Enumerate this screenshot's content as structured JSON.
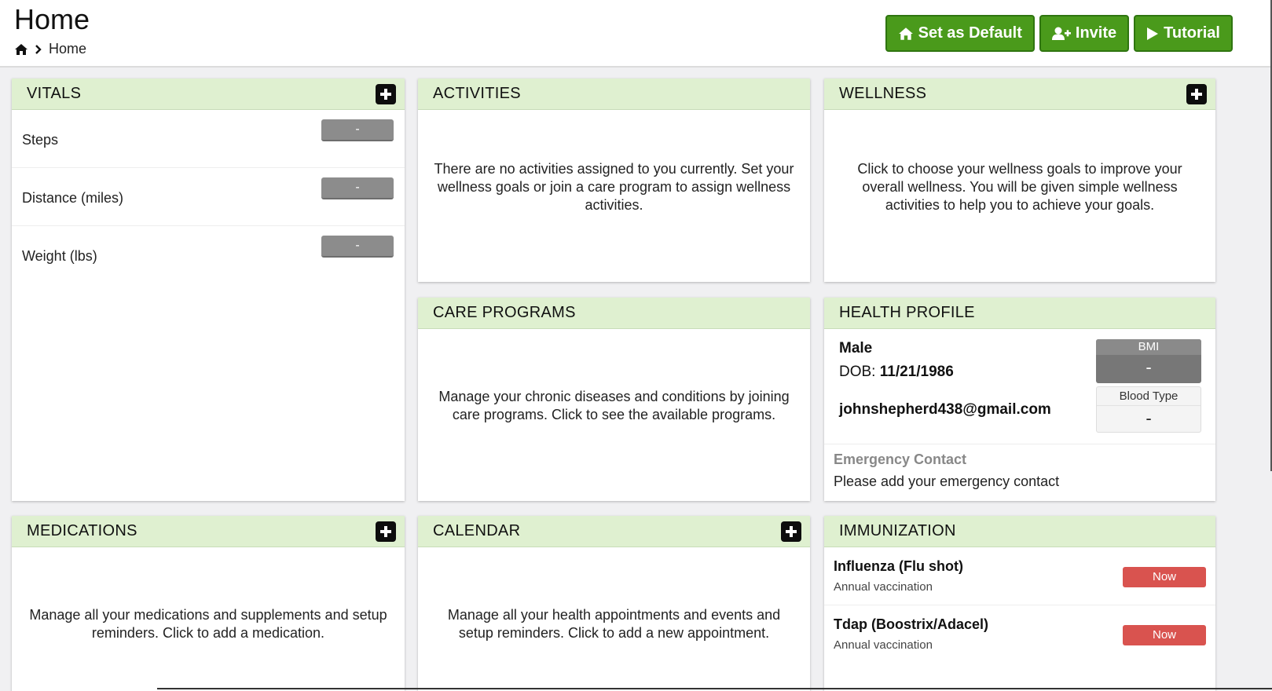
{
  "header": {
    "title": "Home",
    "breadcrumb": {
      "home_icon": "home-icon",
      "separator_icon": "chevron-right-icon",
      "current": "Home"
    },
    "buttons": {
      "set_default": {
        "label": "Set as Default",
        "icon": "home-icon"
      },
      "invite": {
        "label": "Invite",
        "icon": "user-plus-icon"
      },
      "tutorial": {
        "label": "Tutorial",
        "icon": "play-icon"
      }
    }
  },
  "colors": {
    "accent_green": "#4a9a1b",
    "panel_header": "#dff0d0",
    "badge_red": "#d9534f",
    "value_gray": "#8c8c8c"
  },
  "vitals": {
    "title": "VITALS",
    "items": [
      {
        "label": "Steps",
        "value": "-"
      },
      {
        "label": "Distance (miles)",
        "value": "-"
      },
      {
        "label": "Weight (lbs)",
        "value": "-"
      }
    ]
  },
  "activities": {
    "title": "ACTIVITIES",
    "message": "There are no activities assigned to you currently. Set your wellness goals or join a care program to assign wellness activities."
  },
  "wellness": {
    "title": "WELLNESS",
    "message": "Click to choose your wellness goals to improve your overall wellness. You will be given simple wellness activities to help you to achieve your goals."
  },
  "care_programs": {
    "title": "CARE PROGRAMS",
    "message": "Manage your chronic diseases and conditions by joining care programs. Click to see the available programs."
  },
  "health_profile": {
    "title": "HEALTH PROFILE",
    "gender": "Male",
    "dob_label": "DOB:",
    "dob_value": "11/21/1986",
    "email": "johnshepherd438@gmail.com",
    "bmi_label": "BMI",
    "bmi_value": "-",
    "blood_type_label": "Blood Type",
    "blood_type_value": "-",
    "emergency_label": "Emergency Contact",
    "emergency_text": "Please add your emergency contact"
  },
  "medications": {
    "title": "MEDICATIONS",
    "message": "Manage all your medications and supplements and setup reminders. Click to add a medication."
  },
  "calendar": {
    "title": "CALENDAR",
    "message": "Manage all your health appointments and events and setup reminders. Click to add a new appointment."
  },
  "immunization": {
    "title": "IMMUNIZATION",
    "items": [
      {
        "name": "Influenza (Flu shot)",
        "detail": "Annual vaccination",
        "status": "Now"
      },
      {
        "name": "Tdap (Boostrix/Adacel)",
        "detail": "Annual vaccination",
        "status": "Now"
      }
    ]
  }
}
